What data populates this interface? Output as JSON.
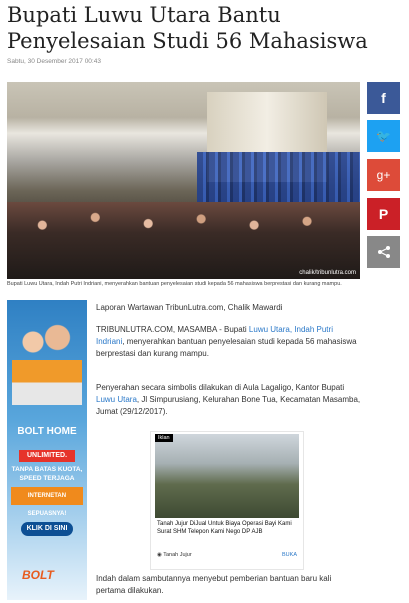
{
  "article": {
    "title": "Bupati Luwu Utara Bantu Penyelesaian Studi 56 Mahasiswa",
    "date": "Sabtu, 30 Desember 2017 00:43",
    "photo_credit": "chalik/tribunlutra.com",
    "caption": "Bupati Luwu Utara, Indah Putri Indriani, menyerahkan bantuan penyelesaian studi kepada 56 mahasiswa berprestasi dan kurang mampu.",
    "reporter": "Laporan Wartawan TribunLutra.com, Chalik Mawardi",
    "p1_prefix": "TRIBUNLUTRA.COM, MASAMBA - Bupati ",
    "p1_link": "Luwu Utara, Indah Putri Indriani",
    "p1_suffix": ", menyerahkan bantuan penyelesaian studi kepada 56 mahasiswa berprestasi dan kurang mampu.",
    "p2_prefix": "Penyerahan secara simbolis dilakukan di Aula Lagaligo, Kantor Bupati ",
    "p2_link": "Luwu Utara",
    "p2_suffix": ", Jl Simpurusiang, Kelurahan Bone Tua, Kecamatan Masamba, Jumat (29/12/2017).",
    "p3": "Indah dalam sambutannya menyebut pemberian bantuan baru kali pertama dilakukan."
  },
  "share": {
    "buttons": [
      {
        "icon": "facebook-icon",
        "glyph": "f",
        "color": "#3b5998"
      },
      {
        "icon": "twitter-icon",
        "glyph": "🐦",
        "color": "#1da1f2"
      },
      {
        "icon": "google-plus-icon",
        "glyph": "g+",
        "color": "#dd4b39"
      },
      {
        "icon": "pinterest-icon",
        "glyph": "P",
        "color": "#cb2027"
      },
      {
        "icon": "share-icon",
        "glyph": "<",
        "color": "#888888"
      }
    ]
  },
  "ad_banner": {
    "brand": "BOLT HOME",
    "pill": "UNLIMITED.",
    "line1": "TANPA BATAS KUOTA,",
    "line2": "SPEED TERJAGA",
    "orange": "INTERNETAN SEPUASNYA!",
    "cta": "KLIK DI SINI",
    "logo": "BOLT"
  },
  "native_ad": {
    "tag": "Iklan",
    "headline": "Tanah Jujur DiJual Untuk Biaya Operasi Bayi Kami Surat SHM Telepon Kami Nego DP AJB",
    "source": "Tanah Jujur",
    "action": "BUKA"
  }
}
